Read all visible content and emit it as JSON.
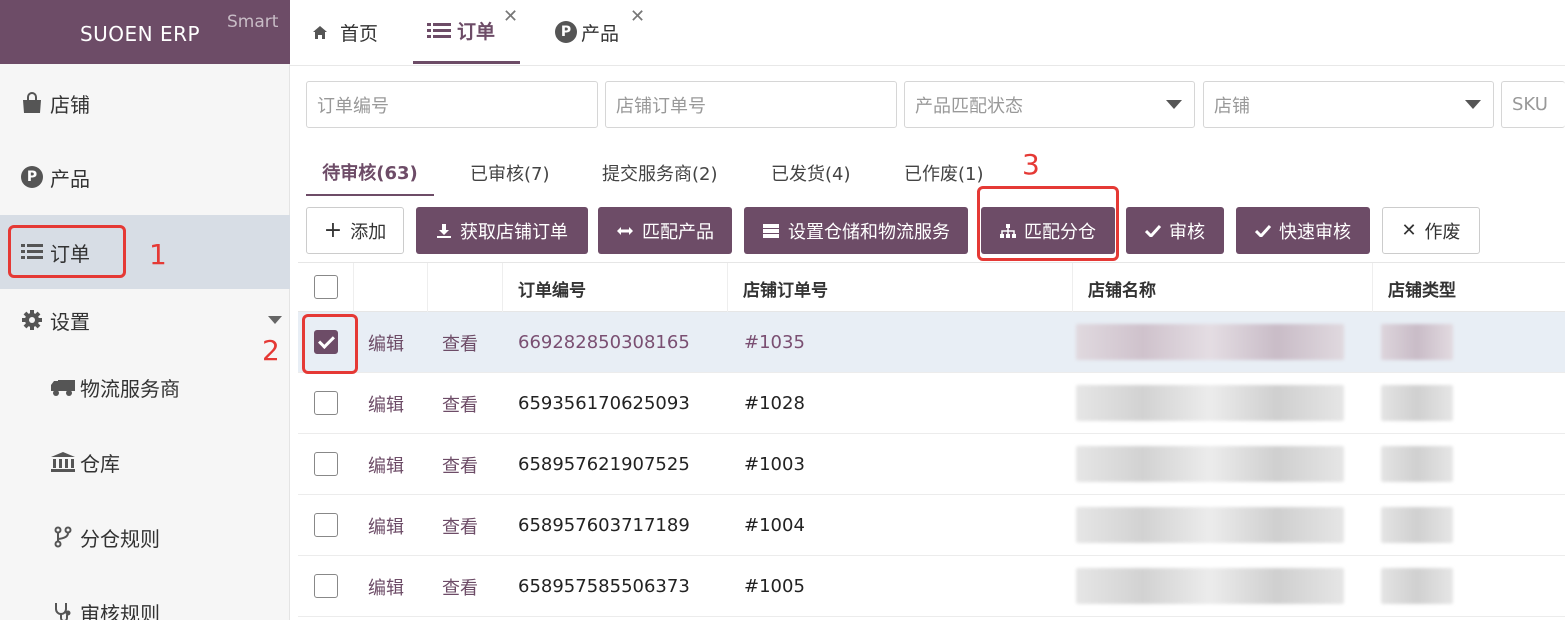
{
  "brand": {
    "title": "SUOEN ERP",
    "subtitle": "Smart"
  },
  "sidebar": {
    "items": [
      {
        "label": "店铺",
        "icon": "shopping-bag-icon"
      },
      {
        "label": "产品",
        "icon": "product-p-icon"
      },
      {
        "label": "订单",
        "icon": "list-icon",
        "active": true
      },
      {
        "label": "设置",
        "icon": "gear-icon"
      }
    ],
    "subitems": [
      {
        "label": "物流服务商",
        "icon": "truck-icon"
      },
      {
        "label": "仓库",
        "icon": "bank-icon"
      },
      {
        "label": "分仓规则",
        "icon": "fork-icon"
      },
      {
        "label": "审核规则",
        "icon": "stethoscope-icon"
      }
    ]
  },
  "tabs": [
    {
      "label": "首页",
      "icon": "home-icon"
    },
    {
      "label": "订单",
      "icon": "list-icon",
      "active": true,
      "closable": true
    },
    {
      "label": "产品",
      "icon": "product-p-icon",
      "closable": true
    }
  ],
  "filters": {
    "order_no": "订单编号",
    "shop_order_no": "店铺订单号",
    "match_status": "产品匹配状态",
    "shop": "店铺",
    "sku": "SKU"
  },
  "status_tabs": [
    "待审核(63)",
    "已审核(7)",
    "提交服务商(2)",
    "已发货(4)",
    "已作废(1)"
  ],
  "actions": [
    {
      "label": "添加",
      "icon": "plus-icon"
    },
    {
      "label": "获取店铺订单",
      "icon": "download-icon"
    },
    {
      "label": "匹配产品",
      "icon": "arrows-h-icon"
    },
    {
      "label": "设置仓储和物流服务",
      "icon": "server-icon"
    },
    {
      "label": "匹配分仓",
      "icon": "sitemap-icon"
    },
    {
      "label": "审核",
      "icon": "check-icon"
    },
    {
      "label": "快速审核",
      "icon": "check-icon"
    },
    {
      "label": "作废",
      "icon": "times-icon"
    }
  ],
  "table": {
    "headers": [
      "订单编号",
      "店铺订单号",
      "店铺名称",
      "店铺类型"
    ],
    "edit_label": "编辑",
    "view_label": "查看",
    "rows": [
      {
        "order_no": "669282850308165",
        "shop_order_no": "#1035",
        "checked": true
      },
      {
        "order_no": "659356170625093",
        "shop_order_no": "#1028",
        "checked": false
      },
      {
        "order_no": "658957621907525",
        "shop_order_no": "#1003",
        "checked": false
      },
      {
        "order_no": "658957603717189",
        "shop_order_no": "#1004",
        "checked": false
      },
      {
        "order_no": "658957585506373",
        "shop_order_no": "#1005",
        "checked": false
      }
    ]
  },
  "annotations": [
    "1",
    "2",
    "3"
  ],
  "colors": {
    "brand": "#6d4c67",
    "annotation": "#e53935",
    "active_nav": "#d7dde5"
  }
}
